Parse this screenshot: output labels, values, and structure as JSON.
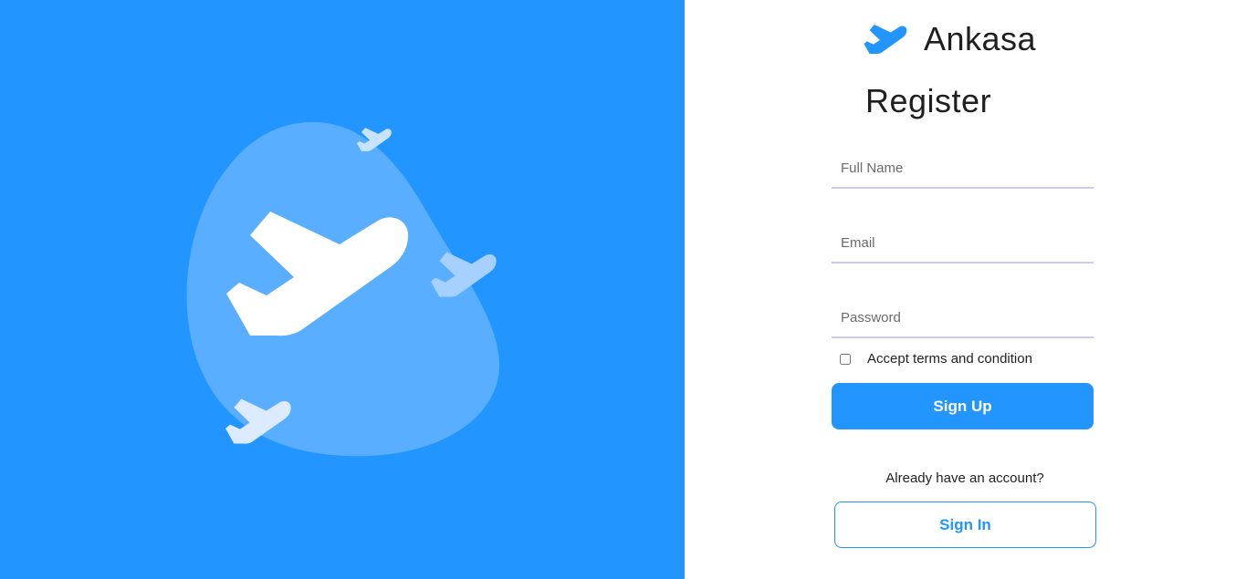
{
  "brand": {
    "name": "Ankasa",
    "icon": "airplane-icon"
  },
  "hero": {
    "illustration": "airplane-blob-illustration",
    "icons": [
      "airplane-icon"
    ]
  },
  "form": {
    "title": "Register",
    "full_name_placeholder": "Full Name",
    "email_placeholder": "Email",
    "password_placeholder": "Password",
    "terms_label": "Accept terms and condition",
    "terms_checked": false,
    "submit_label": "Sign Up"
  },
  "signin": {
    "prompt": "Already have an account?",
    "button_label": "Sign In"
  },
  "colors": {
    "primary": "#2395ff",
    "blob": "#5aaeff",
    "plane_light": "#c8e3ff",
    "field_border": "#d2c8f7"
  }
}
